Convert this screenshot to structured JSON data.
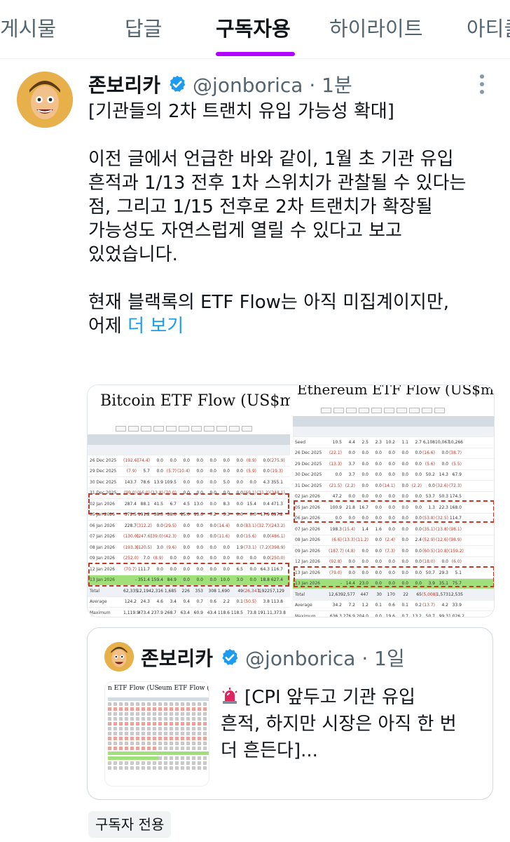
{
  "tabs": [
    {
      "label": "게시물"
    },
    {
      "label": "답글"
    },
    {
      "label": "구독자용"
    },
    {
      "label": "하이라이트"
    },
    {
      "label": "아티클"
    }
  ],
  "colors": {
    "accent": "#b100ff",
    "link": "#1d9bf0",
    "verified": "#1d9bf0"
  },
  "post": {
    "author_name": "존보리카",
    "handle": "@jonborica · 1분",
    "avatar_icon": "avatar-icon",
    "verified_icon": "verified-badge-icon",
    "more_icon": "more-options-icon",
    "lines": [
      "[기관들의 2차 트랜치 유입 가능성 확대]",
      "",
      "이전 글에서 언급한 바와 같이, 1월 초 기관 유입",
      "흔적과 1/13 전후 1차 스위치가 관찰될 수 있다는",
      "점, 그리고 1/15 전후로 2차 트랜치가 확장될",
      "가능성도 자연스럽게 열릴 수 있다고 보고",
      "있었습니다.",
      "",
      "현재 블랙록의 ETF Flow는 아직 미집계이지만,"
    ],
    "last_line_prefix": "어제 ",
    "more_link": "더 보기",
    "media": {
      "left_title": "Bitcoin ETF Flow (US$m)",
      "right_title": "Ethereum ETF Flow (US$m)",
      "left_rows": [
        {
          "date": "26 Dec 2025",
          "vals": [
            "(192.6)",
            "(74.4)",
            "0.0",
            "0.0",
            "0.0",
            "0.0",
            "0.0",
            "0.0",
            "0.0",
            "(8.9)",
            "0.0",
            "(275.9)"
          ]
        },
        {
          "date": "29 Dec 2025",
          "vals": [
            "(7.9)",
            "5.7",
            "0.0",
            "(5.7)",
            "(10.4)",
            "0.0",
            "0.0",
            "0.0",
            "0.0",
            "(5.9)",
            "0.0",
            "(19.3)"
          ]
        },
        {
          "date": "30 Dec 2025",
          "vals": [
            "143.7",
            "78.6",
            "13.9",
            "109.5",
            "0.0",
            "0.0",
            "0.0",
            "5.0",
            "0.0",
            "0.0",
            "4.3",
            "355.1"
          ]
        },
        {
          "date": "31 Dec 2025",
          "vals": [
            "(99.0)",
            "(66.0)",
            "(13.8)",
            "(70.0)",
            "0.0",
            "0.0",
            "0.0",
            "0.0",
            "0.0",
            "(69.1)",
            "(31.2)",
            "(348.1)"
          ]
        },
        {
          "date": "02 Jan 2026",
          "vals": [
            "287.4",
            "88.1",
            "41.5",
            "6.7",
            "4.5",
            "13.0",
            "0.0",
            "8.3",
            "0.0",
            "15.4",
            "0.4",
            "471.3"
          ]
        },
        {
          "date": "05 Jan 2026",
          "vals": [
            "372.5",
            "191.2",
            "38.5",
            "38.0",
            "15.0",
            "13.6",
            "7.2",
            "5.3",
            "0.0",
            "0.0",
            "17.9",
            "697.2"
          ]
        },
        {
          "date": "06 Jan 2026",
          "vals": [
            "228.7",
            "(312.2)",
            "0.0",
            "(29.5)",
            "0.0",
            "0.0",
            "0.0",
            "(14.4)",
            "0.0",
            "(83.1)",
            "(32.7)",
            "(243.2)"
          ]
        },
        {
          "date": "07 Jan 2026",
          "vals": [
            "(130.0)",
            "(247.6)",
            "(39.0)",
            "(42.3)",
            "0.0",
            "0.0",
            "0.0",
            "(11.6)",
            "0.0",
            "(15.6)",
            "0.0",
            "(486.1)"
          ]
        },
        {
          "date": "08 Jan 2026",
          "vals": [
            "(193.3)",
            "(120.5)",
            "3.0",
            "(9.6)",
            "0.0",
            "0.0",
            "0.0",
            "0.0",
            "1.9",
            "(73.1)",
            "(7.2)",
            "(398.9)"
          ]
        },
        {
          "date": "09 Jan 2026",
          "vals": [
            "(252.0)",
            "7.0",
            "(8.9)",
            "0.0",
            "0.0",
            "0.0",
            "0.0",
            "0.0",
            "0.0",
            "0.0",
            "0.0",
            "(250.0)"
          ]
        },
        {
          "date": "12 Jan 2026",
          "vals": [
            "(70.7)",
            "111.7",
            "0.0",
            "0.0",
            "0.0",
            "0.0",
            "0.0",
            "0.0",
            "6.5",
            "0.0",
            "64.3",
            "116.7"
          ]
        },
        {
          "date": "13 Jan 2026",
          "vals": [
            "-",
            "351.4",
            "159.4",
            "84.9",
            "0.0",
            "0.0",
            "0.0",
            "10.0",
            "3.0",
            "0.0",
            "18.8",
            "627.4"
          ]
        },
        {
          "date": "Total",
          "vals": [
            "62,335",
            "12,194",
            "2,316",
            "1,685",
            "226",
            "353",
            "308",
            "1,690",
            "49",
            "(26,347)",
            "1,922",
            "57,129"
          ]
        },
        {
          "date": "Average",
          "vals": [
            "124.2",
            "24.3",
            "4.6",
            "3.4",
            "0.4",
            "0.7",
            "0.6",
            "2.2",
            "0.1",
            "(50.5)",
            "3.8",
            "113.8"
          ]
        },
        {
          "date": "Maximum",
          "vals": [
            "1,119.9",
            "473.4",
            "237.9",
            "268.7",
            "63.4",
            "60.9",
            "43.4",
            "118.6",
            "118.5",
            "73.8",
            "191.1",
            "1,373.8"
          ]
        }
      ],
      "right_rows": [
        {
          "date": "Seed",
          "vals": [
            "10.5",
            "4.4",
            "2.5",
            "2.3",
            "10.2",
            "1.1",
            "2.7",
            "6,108",
            "10,067",
            "10,266"
          ]
        },
        {
          "date": "26 Dec 2025",
          "vals": [
            "(22.1)",
            "0.0",
            "0.0",
            "0.0",
            "0.0",
            "0.0",
            "0.0",
            "(16.6)",
            "0.0",
            "(38.7)"
          ]
        },
        {
          "date": "29 Dec 2025",
          "vals": [
            "(13.3)",
            "3.7",
            "0.0",
            "0.0",
            "0.0",
            "0.0",
            "0.0",
            "(5.6)",
            "0.0",
            "(5.5)"
          ]
        },
        {
          "date": "30 Dec 2025",
          "vals": [
            "0.0",
            "3.7",
            "0.0",
            "0.0",
            "0.0",
            "0.0",
            "0.0",
            "50.2",
            "14.3",
            "67.9"
          ]
        },
        {
          "date": "31 Dec 2025",
          "vals": [
            "(21.5)",
            "(2.2)",
            "0.0",
            "0.0",
            "(14.1)",
            "0.0",
            "(2.2)",
            "0.0",
            "(32.6)",
            "(72.3)"
          ]
        },
        {
          "date": "02 Jan 2026",
          "vals": [
            "47.2",
            "0.0",
            "0.0",
            "0.0",
            "0.0",
            "0.0",
            "0.0",
            "53.7",
            "50.3",
            "174.5"
          ]
        },
        {
          "date": "05 Jan 2026",
          "vals": [
            "100.9",
            "21.8",
            "16.7",
            "0.0",
            "0.0",
            "0.0",
            "0.0",
            "1.3",
            "22.3",
            "168.0"
          ]
        },
        {
          "date": "06 Jan 2026",
          "vals": [
            "0.0",
            "0.0",
            "0.0",
            "0.0",
            "0.0",
            "0.0",
            "0.0",
            "(53.8)",
            "(32.5)",
            "114.7"
          ]
        },
        {
          "date": "07 Jan 2026",
          "vals": [
            "198.3",
            "(15.4)",
            "1.4",
            "1.6",
            "0.0",
            "0.0",
            "0.0",
            "(35.1)",
            "(13.8)",
            "(98.1)"
          ]
        },
        {
          "date": "08 Jan 2026",
          "vals": [
            "(6.6)",
            "(13.3)",
            "(11.2)",
            "0.0",
            "(2.4)",
            "0.0",
            "2.4",
            "(52.9)",
            "(12.6)",
            "(98.9)"
          ]
        },
        {
          "date": "09 Jan 2026",
          "vals": [
            "(187.7)",
            "(4.8)",
            "0.0",
            "0.0",
            "(7.3)",
            "0.0",
            "0.0",
            "(60.5)",
            "(10.8)",
            "(159.2)"
          ]
        },
        {
          "date": "12 Jan 2026",
          "vals": [
            "(92.8)",
            "0.0",
            "0.0",
            "0.0",
            "0.0",
            "0.0",
            "0.0",
            "(18.0)",
            "0.0",
            "(6.0)"
          ]
        },
        {
          "date": "13 Jan 2026",
          "vals": [
            "(79.0)",
            "0.0",
            "0.0",
            "0.0",
            "0.0",
            "0.0",
            "0.0",
            "50.7",
            "29.3",
            "5.1"
          ]
        },
        {
          "date": "13 Jan 2026",
          "vals": [
            "-",
            "14.4",
            "23.0",
            "0.0",
            "0.0",
            "0.0",
            "0.0",
            "3.9",
            "35.1",
            "75.7"
          ]
        },
        {
          "date": "Total",
          "vals": [
            "12,639",
            "2,577",
            "447",
            "30",
            "170",
            "22",
            "65",
            "(5,008)",
            "1,573",
            "12,535"
          ]
        },
        {
          "date": "Average",
          "vals": [
            "34.2",
            "7.2",
            "1.2",
            "0.1",
            "0.6",
            "0.1",
            "0.2",
            "(13.7)",
            "4.2",
            "33.9"
          ]
        },
        {
          "date": "Maximum",
          "vals": [
            "636.3",
            "276.9",
            "204.0",
            "0.0",
            "19.6",
            "0.7",
            "13.2",
            "50.7",
            "99.3",
            "1,026.2"
          ]
        }
      ]
    }
  },
  "quote": {
    "author_name": "존보리카",
    "handle": "@jonborica · 1일",
    "thumb_left_title": "n ETF Flow (US",
    "thumb_right_title": "eum ETF Flow (",
    "lines": [
      "[CPI 앞두고 기관 유입",
      "흔적, 하지만 시장은 아직 한 번",
      "더 흔든다]..."
    ],
    "siren_icon": "siren-icon"
  },
  "badge": "구독자 전용"
}
